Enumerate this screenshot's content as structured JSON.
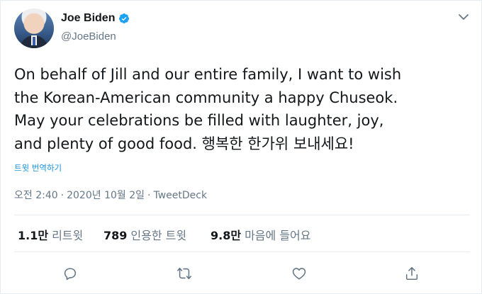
{
  "colors": {
    "text": "#14171a",
    "secondary": "#657786",
    "accent": "#1b95e0",
    "verified": "#1da1f2",
    "divider": "#e6ecf0"
  },
  "author": {
    "name": "Joe Biden",
    "handle": "@JoeBiden",
    "verified_icon": "verified-badge-icon",
    "avatar_icon": "profile-avatar"
  },
  "tweet": {
    "text": "On behalf of Jill and our entire family, I want to wish\nthe Korean-American community a happy Chuseok.\nMay your celebrations be filled with laughter, joy,\nand plenty of good food. 행복한 한가위 보내세요!",
    "translate_label": "트윗 번역하기",
    "time": "오전 2:40",
    "date": "2020년 10월 2일",
    "separator": "·",
    "source": "TweetDeck"
  },
  "stats": {
    "retweets": {
      "value": "1.1만",
      "label": "리트윗"
    },
    "quote_tweets": {
      "value": "789",
      "label": "인용한 트윗"
    },
    "likes": {
      "value": "9.8만",
      "label": "마음에 들어요"
    }
  },
  "actions": [
    {
      "name": "reply",
      "icon": "reply-icon"
    },
    {
      "name": "retweet",
      "icon": "retweet-icon"
    },
    {
      "name": "like",
      "icon": "heart-icon"
    },
    {
      "name": "share",
      "icon": "share-icon"
    }
  ]
}
